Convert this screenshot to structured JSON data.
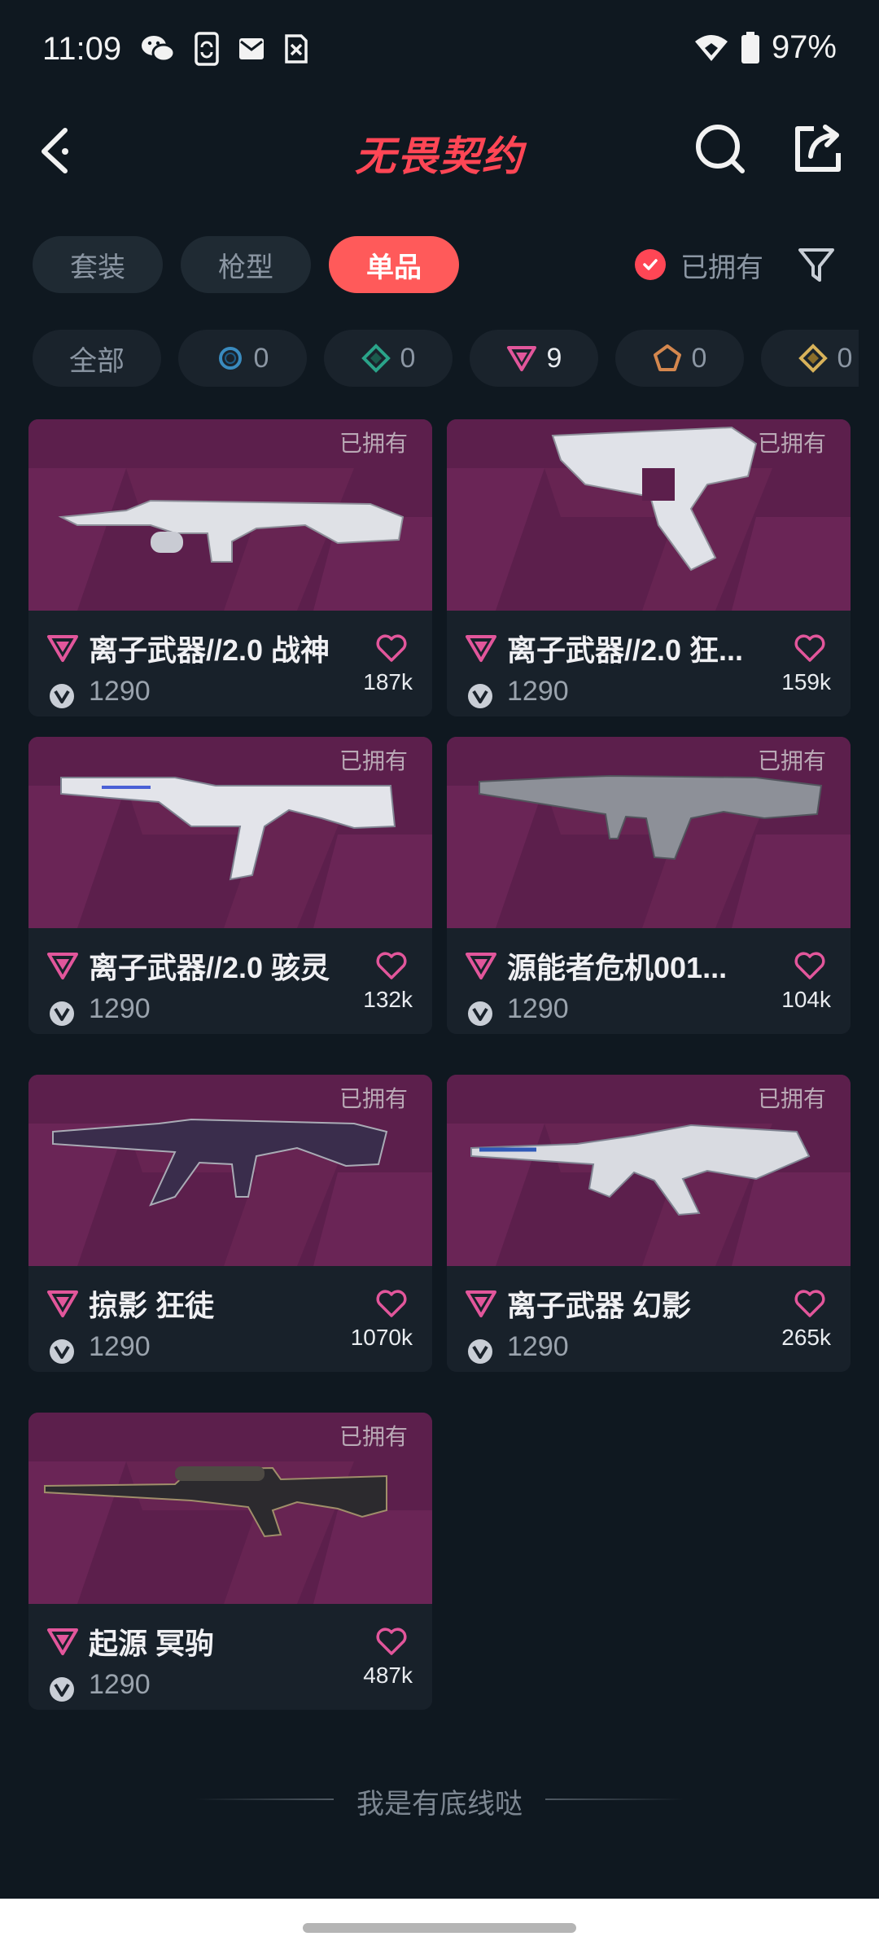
{
  "status_bar": {
    "time": "11:09",
    "battery": "97%"
  },
  "header": {
    "title": "无畏契约"
  },
  "tabs": [
    {
      "label": "套装",
      "active": false
    },
    {
      "label": "枪型",
      "active": false
    },
    {
      "label": "单品",
      "active": true
    }
  ],
  "owned_filter": {
    "label": "已拥有",
    "checked": true
  },
  "rarity_chips": [
    {
      "label": "全部"
    },
    {
      "count": "0",
      "color": "#3a8bbf",
      "shape": "circle"
    },
    {
      "count": "0",
      "color": "#2aa389",
      "shape": "diamond"
    },
    {
      "count": "9",
      "color": "#e2569b",
      "shape": "triangle"
    },
    {
      "count": "0",
      "color": "#d4874e",
      "shape": "pentagon"
    },
    {
      "count": "0",
      "color": "#d8b25a",
      "shape": "diamond"
    }
  ],
  "items": [
    {
      "name": "离子武器//2.0 战神",
      "price": "1290",
      "likes": "187k",
      "owned_label": "已拥有"
    },
    {
      "name": "离子武器//2.0 狂...",
      "price": "1290",
      "likes": "159k",
      "owned_label": "已拥有"
    },
    {
      "name": "离子武器//2.0 骇灵",
      "price": "1290",
      "likes": "132k",
      "owned_label": "已拥有"
    },
    {
      "name": "源能者危机001...",
      "price": "1290",
      "likes": "104k",
      "owned_label": "已拥有"
    },
    {
      "name": "掠影 狂徒",
      "price": "1290",
      "likes": "1070k",
      "owned_label": "已拥有"
    },
    {
      "name": "离子武器 幻影",
      "price": "1290",
      "likes": "265k",
      "owned_label": "已拥有"
    },
    {
      "name": "起源 冥驹",
      "price": "1290",
      "likes": "487k",
      "owned_label": "已拥有"
    }
  ],
  "footer": {
    "end_text": "我是有底线哒"
  },
  "colors": {
    "accent": "#ff4655",
    "card_art_bg": "#5c1f4c",
    "heart": "#e2569b"
  }
}
